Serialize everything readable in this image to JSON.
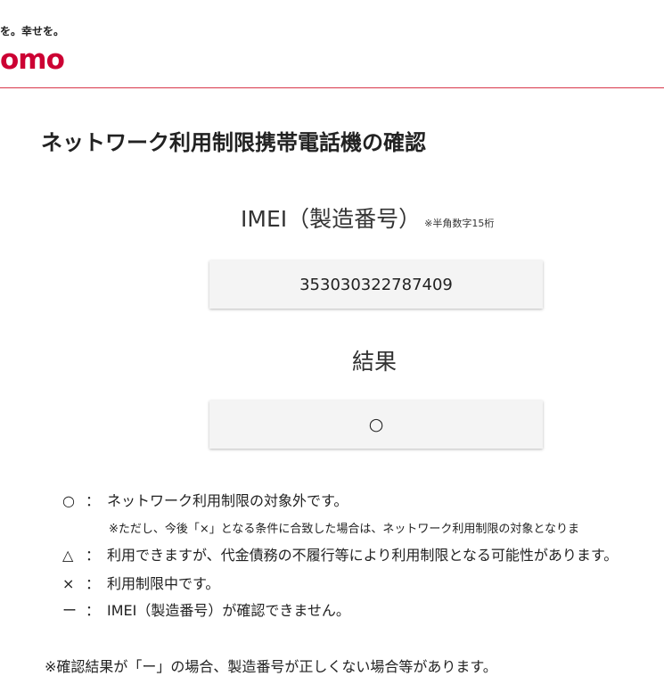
{
  "header": {
    "tagline": "を。幸せを。",
    "brand": "omo"
  },
  "page": {
    "title": "ネットワーク利用制限携帯電話機の確認"
  },
  "imei": {
    "label": "IMEI（製造番号）",
    "note": "※半角数字15桁",
    "value": "353030322787409"
  },
  "result": {
    "label": "結果",
    "value": "○"
  },
  "legend": {
    "circle": {
      "symbol": "○",
      "colon": "：",
      "text": "ネットワーク利用制限の対象外です。"
    },
    "circle_note": "※ただし、今後「×」となる条件に合致した場合は、ネットワーク利用制限の対象となりま",
    "triangle": {
      "symbol": "△",
      "colon": "：",
      "text": "利用できますが、代金債務の不履行等により利用制限となる可能性があります。"
    },
    "cross": {
      "symbol": "×",
      "colon": "：",
      "text": "利用制限中です。"
    },
    "dash": {
      "symbol": "ー",
      "colon": "：",
      "text": "IMEI（製造番号）が確認できません。"
    }
  },
  "footer": {
    "text": "※確認結果が「ー」の場合、製造番号が正しくない場合等があります。"
  },
  "colors": {
    "brand_red": "#cc0033",
    "header_rule": "#d9374b",
    "field_bg": "#f4f4f4"
  }
}
